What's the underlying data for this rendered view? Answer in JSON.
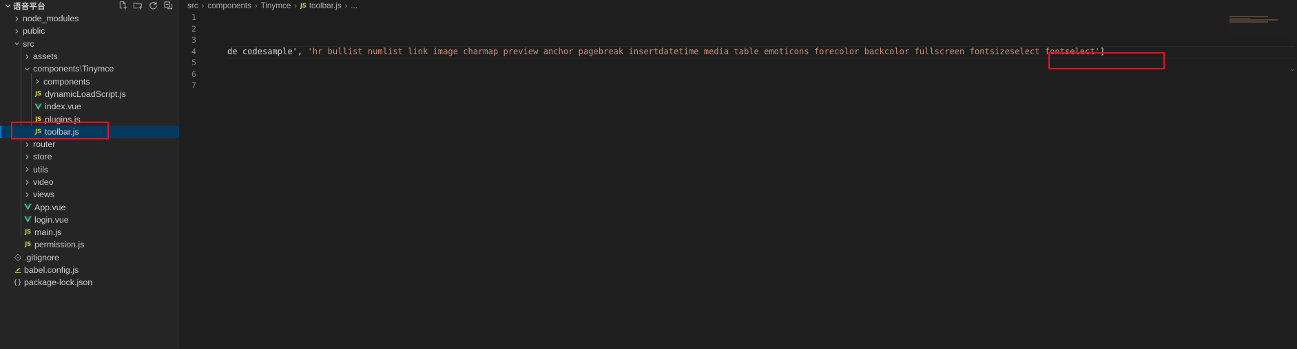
{
  "window": {
    "theme_bg": "#1e1e1e",
    "sidebar_bg": "#252526",
    "accent": "#0078d4",
    "selection_bg": "#04395e",
    "annotation_color": "#e81123"
  },
  "sidebar": {
    "title": "语音平台",
    "header_actions": [
      {
        "name": "new-file-icon",
        "label": "New File"
      },
      {
        "name": "new-folder-icon",
        "label": "New Folder"
      },
      {
        "name": "refresh-icon",
        "label": "Refresh Explorer"
      },
      {
        "name": "collapse-all-icon",
        "label": "Collapse Folders in Explorer"
      }
    ],
    "tree": [
      {
        "label": "node_modules",
        "type": "folder",
        "expanded": false,
        "depth": 1,
        "icon": "chevron-right-icon"
      },
      {
        "label": "public",
        "type": "folder",
        "expanded": false,
        "depth": 1,
        "icon": "chevron-right-icon"
      },
      {
        "label": "src",
        "type": "folder",
        "expanded": true,
        "depth": 1,
        "icon": "chevron-down-icon"
      },
      {
        "label": "assets",
        "type": "folder",
        "expanded": false,
        "depth": 2,
        "icon": "chevron-right-icon"
      },
      {
        "label": "components",
        "label2": "\\",
        "label3": "Tinymce",
        "type": "folder",
        "expanded": true,
        "depth": 2,
        "icon": "chevron-down-icon"
      },
      {
        "label": "components",
        "type": "folder",
        "expanded": false,
        "depth": 3,
        "icon": "chevron-right-icon"
      },
      {
        "label": "dynamicLoadScript.js",
        "type": "js",
        "depth": 3,
        "icon": "js-file-icon"
      },
      {
        "label": "index.vue",
        "type": "vue",
        "depth": 3,
        "icon": "vue-file-icon"
      },
      {
        "label": "plugins.js",
        "type": "js",
        "depth": 3,
        "icon": "js-file-icon"
      },
      {
        "label": "toolbar.js",
        "type": "js",
        "depth": 3,
        "icon": "js-file-icon",
        "selected": true,
        "annotated": true
      },
      {
        "label": "router",
        "type": "folder",
        "expanded": false,
        "depth": 2,
        "icon": "chevron-right-icon"
      },
      {
        "label": "store",
        "type": "folder",
        "expanded": false,
        "depth": 2,
        "icon": "chevron-right-icon"
      },
      {
        "label": "utils",
        "type": "folder",
        "expanded": false,
        "depth": 2,
        "icon": "chevron-right-icon"
      },
      {
        "label": "video",
        "type": "folder",
        "expanded": false,
        "depth": 2,
        "icon": "chevron-right-icon"
      },
      {
        "label": "views",
        "type": "folder",
        "expanded": false,
        "depth": 2,
        "icon": "chevron-right-icon"
      },
      {
        "label": "App.vue",
        "type": "vue",
        "depth": 2,
        "icon": "vue-file-icon"
      },
      {
        "label": "login.vue",
        "type": "vue",
        "depth": 2,
        "icon": "vue-file-icon"
      },
      {
        "label": "main.js",
        "type": "js",
        "depth": 2,
        "icon": "js-file-icon"
      },
      {
        "label": "permission.js",
        "type": "js",
        "depth": 2,
        "icon": "js-file-icon"
      },
      {
        "label": ".gitignore",
        "type": "git",
        "depth": 1,
        "icon": "git-file-icon"
      },
      {
        "label": "babel.config.js",
        "type": "babel",
        "depth": 1,
        "icon": "babel-file-icon"
      },
      {
        "label": "package-lock.json",
        "type": "json",
        "depth": 1,
        "icon": "json-file-icon"
      }
    ]
  },
  "breadcrumb": {
    "items": [
      "src",
      "components",
      "Tinymce",
      "toolbar.js",
      "..."
    ],
    "file_icon_label": "JS",
    "separator": "›"
  },
  "editor": {
    "line_numbers": [
      "1",
      "2",
      "3",
      "4",
      "5",
      "6",
      "7"
    ],
    "current_line": 4,
    "lines": [
      {
        "n": 1,
        "text": ""
      },
      {
        "n": 2,
        "text": ""
      },
      {
        "n": 3,
        "text": ""
      },
      {
        "n": 4,
        "text": "de codesample', 'hr bullist numlist link image charmap preview anchor pagebreak insertdatetime media table emoticons forecolor backcolor fullscreen fontsizeselect fontselect']"
      },
      {
        "n": 5,
        "text": ""
      },
      {
        "n": 6,
        "text": ""
      },
      {
        "n": 7,
        "text": ""
      }
    ],
    "code_prefix": "de codesample', ",
    "code_string": "'hr bullist numlist link image charmap preview anchor pagebreak insertdatetime media table emoticons forecolor backcolor fullscreen fontsizeselect fontselect'",
    "code_suffix": "]",
    "highlighted_text": "fontsizeselect fontselect'"
  },
  "annotations": [
    {
      "name": "toolbar-js-highlight",
      "target": "toolbar.js"
    },
    {
      "name": "fontselect-highlight",
      "target": "fontsizeselect fontselect"
    }
  ]
}
